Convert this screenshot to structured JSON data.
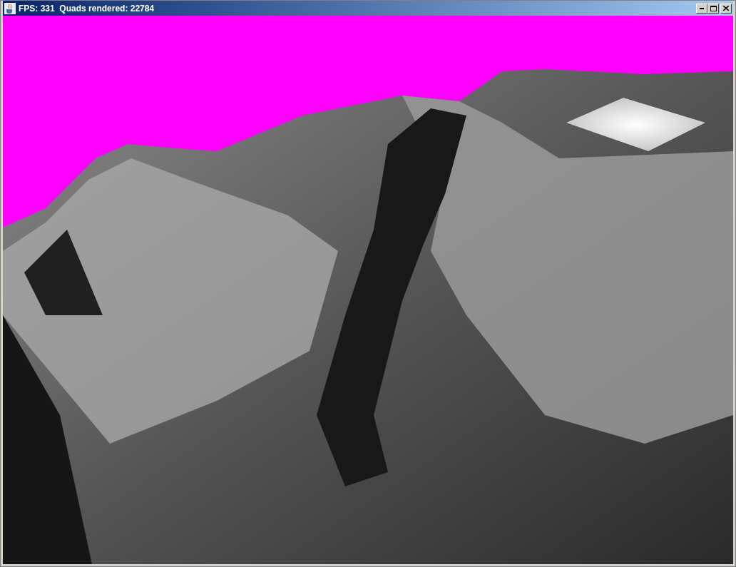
{
  "window": {
    "title": "FPS: 331  Quads rendered: 22784"
  }
}
